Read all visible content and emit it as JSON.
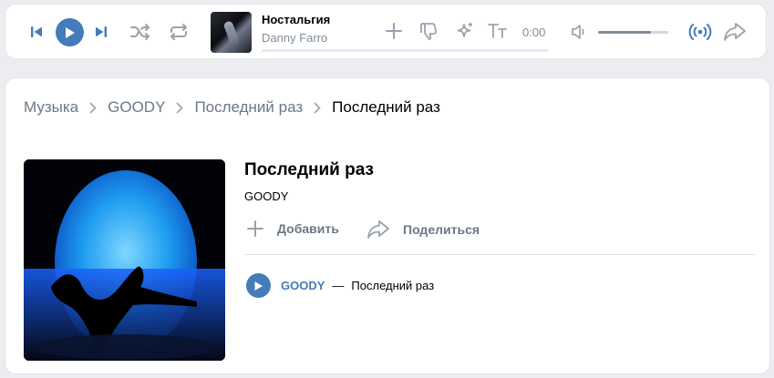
{
  "player": {
    "track_title": "Ностальгия",
    "track_artist": "Danny Farro",
    "time": "0:00",
    "volume_level": 0.75,
    "icons": [
      "prev-icon",
      "play-icon",
      "next-icon",
      "shuffle-icon",
      "repeat-icon",
      "add-icon",
      "dislike-icon",
      "sparkle-icon",
      "text-size-icon",
      "volume-icon",
      "broadcast-icon",
      "share-icon"
    ],
    "accent_color": "#447bba"
  },
  "breadcrumb": {
    "items": [
      "Музыка",
      "GOODY",
      "Последний раз",
      "Последний раз"
    ]
  },
  "album": {
    "title": "Последний раз",
    "artist": "GOODY",
    "add_label": "Добавить",
    "share_label": "Поделиться"
  },
  "tracks": [
    {
      "artist": "GOODY",
      "dash": "—",
      "title": "Последний раз"
    }
  ]
}
